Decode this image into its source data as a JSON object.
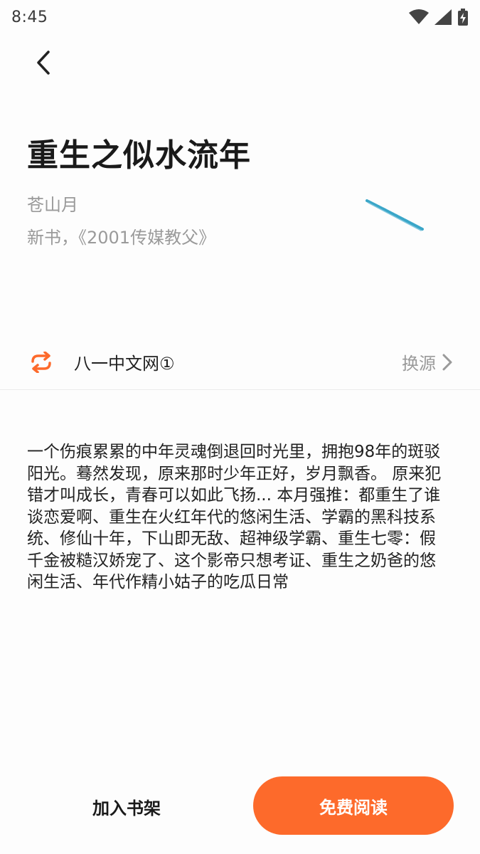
{
  "status_bar": {
    "time": "8:45",
    "icons": [
      "wifi-icon",
      "signal-icon",
      "battery-charging-icon"
    ]
  },
  "nav": {
    "back_icon": "chevron-left-icon"
  },
  "book": {
    "title": "重生之似水流年",
    "author": "苍山月",
    "tagline": "新书，《2001传媒教父》"
  },
  "source": {
    "icon": "refresh-swap-icon",
    "name": "八一中文网①",
    "switch_label": "换源",
    "switch_icon": "chevron-right-icon"
  },
  "description": "一个伤痕累累的中年灵魂倒退回时光里，拥抱98年的斑驳阳光。蓦然发现，原来那时少年正好，岁月飘香。 原来犯错才叫成长，青春可以如此飞扬... 本月强推：都重生了谁谈恋爱啊、重生在火红年代的悠闲生活、学霸的黑科技系统、修仙十年，下山即无敌、超神级学霸、重生七零：假千金被糙汉娇宠了、这个影帝只想考证、重生之奶爸的悠闲生活、年代作精小姑子的吃瓜日常",
  "actions": {
    "add_to_shelf": "加入书架",
    "read_free": "免费阅读"
  },
  "colors": {
    "accent": "#fd6a2b",
    "muted_text": "#9a9a9a",
    "cover_stroke": "#3aa6c8"
  }
}
